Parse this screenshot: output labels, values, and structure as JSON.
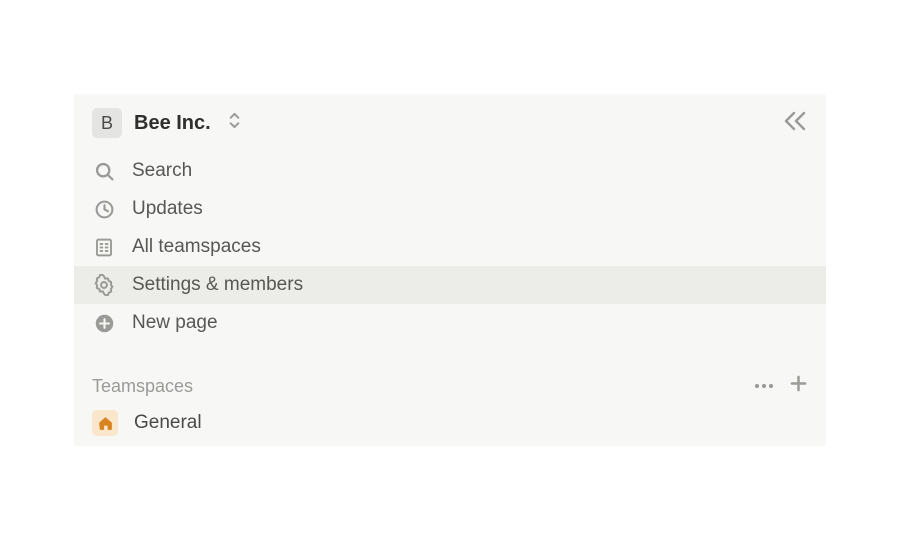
{
  "workspace": {
    "initial": "B",
    "name": "Bee Inc."
  },
  "nav": {
    "search": "Search",
    "updates": "Updates",
    "all_teamspaces": "All teamspaces",
    "settings_members": "Settings & members",
    "new_page": "New page"
  },
  "section": {
    "teamspaces_title": "Teamspaces"
  },
  "teamspaces": [
    {
      "label": "General"
    }
  ]
}
